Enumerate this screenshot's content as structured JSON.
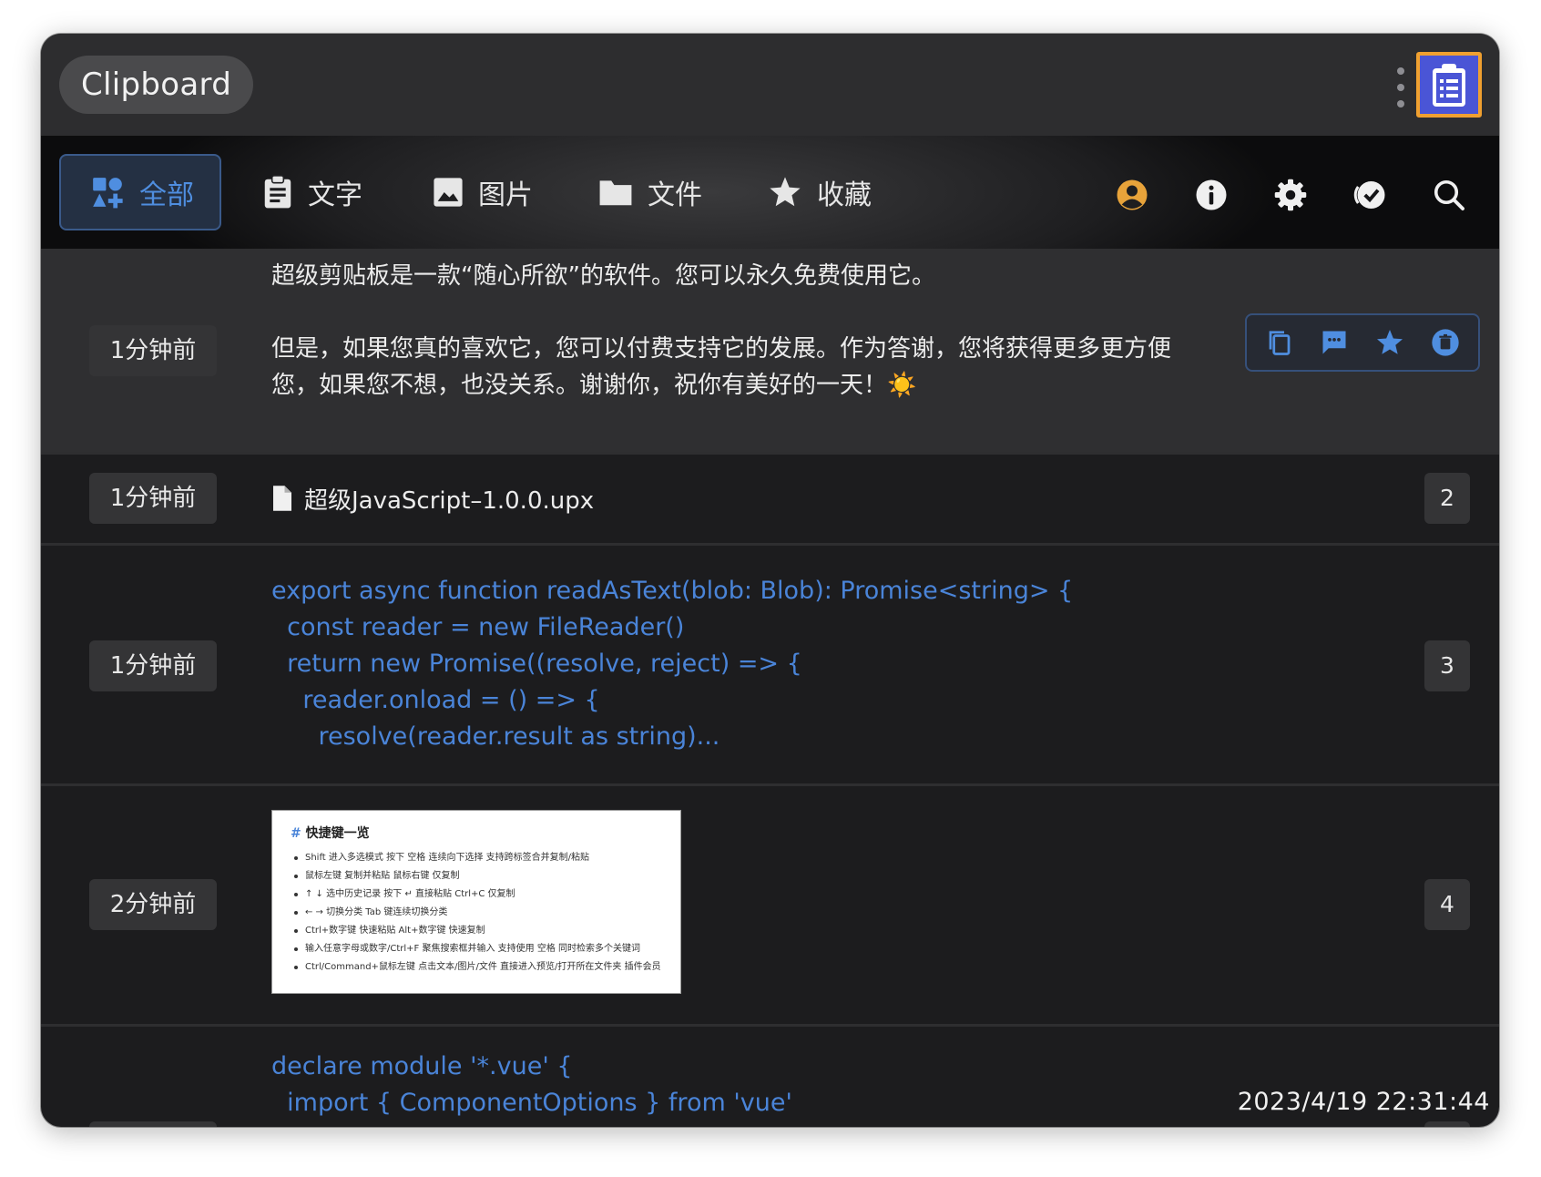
{
  "window": {
    "title": "Clipboard"
  },
  "tabs": [
    {
      "label": "全部",
      "icon": "category-icon",
      "active": true
    },
    {
      "label": "文字",
      "icon": "clipboard-text-icon"
    },
    {
      "label": "图片",
      "icon": "image-icon"
    },
    {
      "label": "文件",
      "icon": "folder-icon"
    },
    {
      "label": "收藏",
      "icon": "star-icon"
    }
  ],
  "toolbar": [
    "account-icon",
    "info-icon",
    "settings-icon",
    "check-all-icon",
    "search-icon"
  ],
  "colors": {
    "accent": "#4f8ee0",
    "code": "#4a84d8",
    "account": "#e8a33a"
  },
  "items": [
    {
      "time": "1分钟前",
      "type": "text",
      "lines": [
        "超级剪贴板是一款“随心所欲”的软件。您可以永久免费使用它。",
        "",
        "但是，如果您真的喜欢它，您可以付费支持它的发展。作为答谢，您将获得更多更方便",
        "您，如果您不想，也没关系。谢谢你，祝你有美好的一天！☀️"
      ],
      "actions": [
        "copy-icon",
        "comment-icon",
        "favorite-icon",
        "delete-icon"
      ]
    },
    {
      "time": "1分钟前",
      "type": "file",
      "filename": "超级JavaScript–1.0.0.upx",
      "index": "2"
    },
    {
      "time": "1分钟前",
      "type": "code",
      "lines": [
        "export async function readAsText(blob: Blob): Promise<string> {",
        "  const reader = new FileReader()",
        "  return new Promise((resolve, reject) => {",
        "    reader.onload = () => {",
        "      resolve(reader.result as string)..."
      ],
      "index": "3"
    },
    {
      "time": "2分钟前",
      "type": "image",
      "thumb": {
        "heading_hash": "#",
        "heading": "快捷键一览",
        "lines": [
          "Shift 进入多选模式 按下 空格 连续向下选择 支持跨标签合并复制/粘贴",
          "鼠标左键 复制并粘贴 鼠标右键 仅复制",
          "↑ ↓ 选中历史记录 按下 ↵ 直接粘贴 Ctrl+C 仅复制",
          "← → 切换分类 Tab 键连续切换分类",
          "Ctrl+数字键 快速粘贴 Alt+数字键 快速复制",
          "输入任意字母或数字/Ctrl+F 聚焦搜索框并输入 支持使用 空格 同时检索多个关键词",
          "Ctrl/Command+鼠标左键 点击文本/图片/文件 直接进入预览/打开所在文件夹 插件会员"
        ]
      },
      "index": "4"
    },
    {
      "time": "",
      "type": "code",
      "lines": [
        "declare module '*.vue' {",
        "  import { ComponentOptions } from 'vue'"
      ]
    }
  ],
  "datetime": "2023/4/19 22:31:44"
}
